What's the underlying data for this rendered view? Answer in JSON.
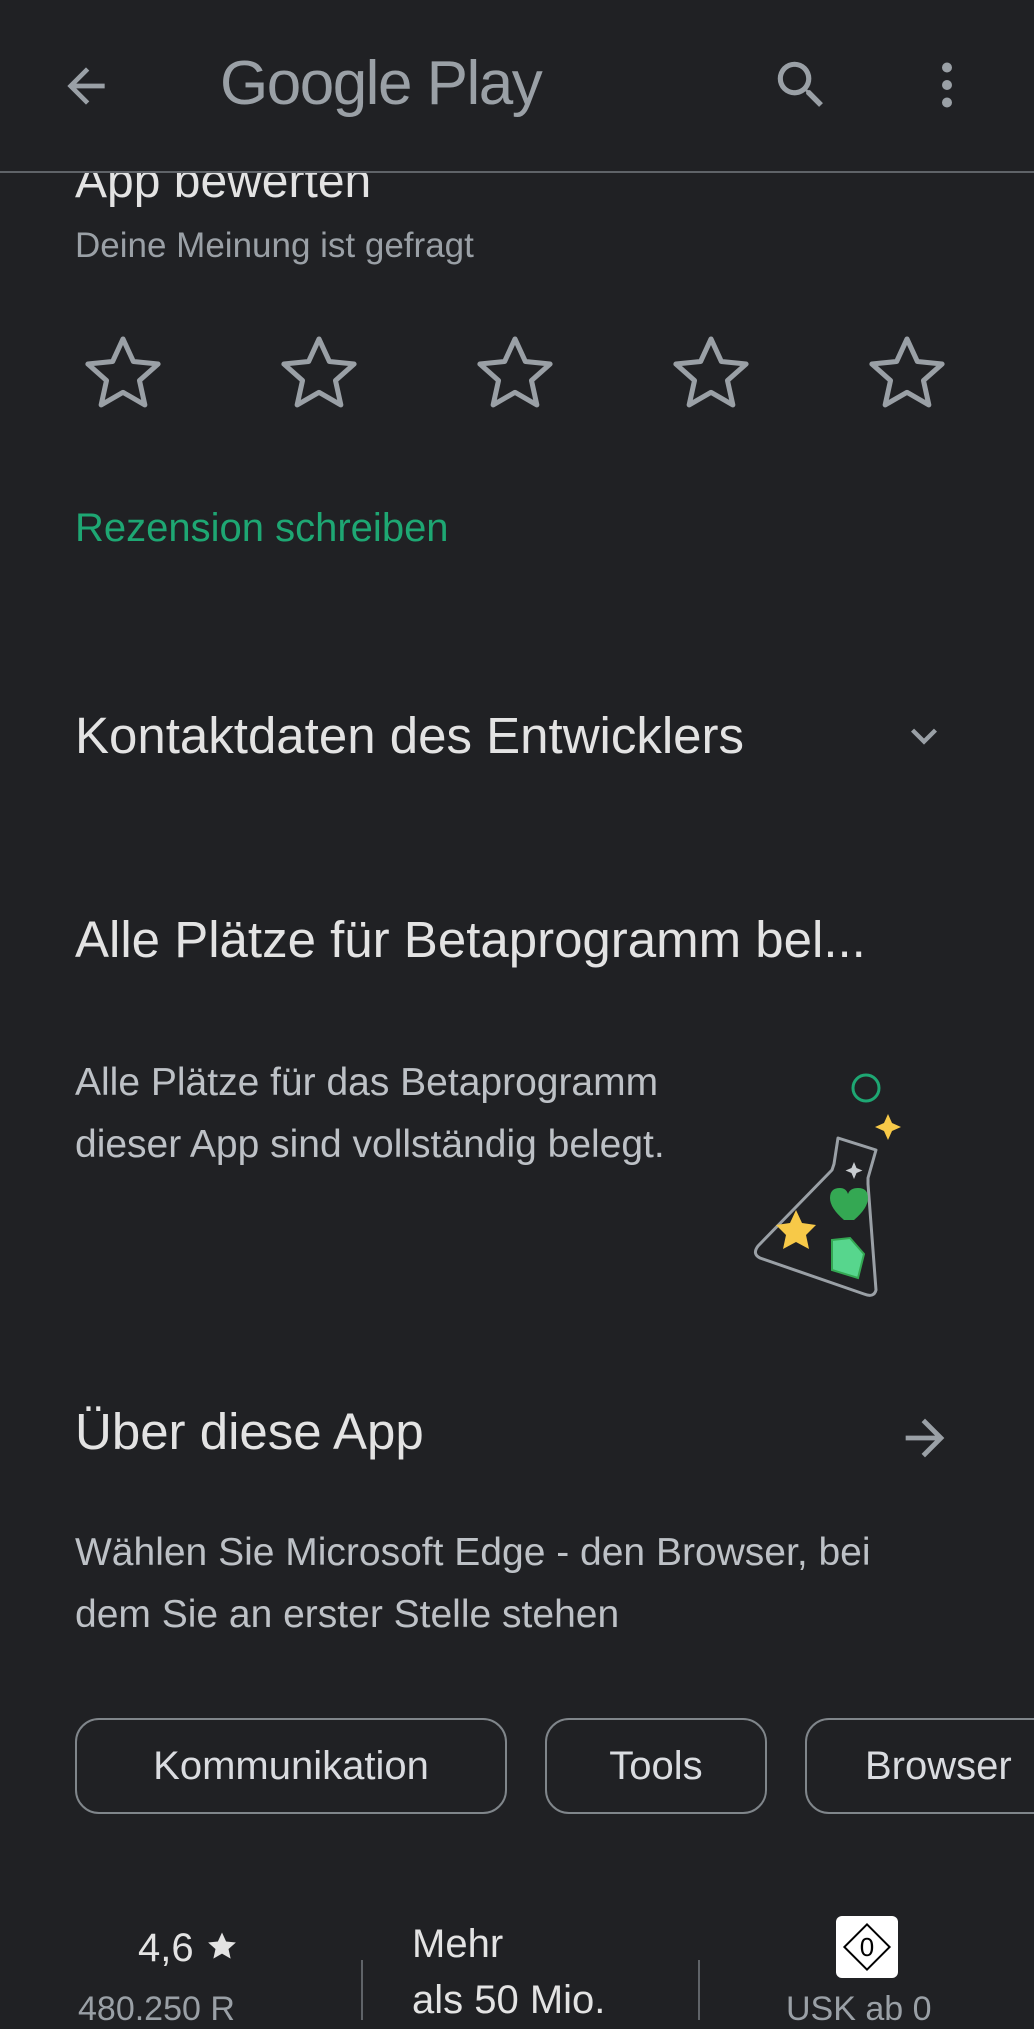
{
  "header": {
    "brand": "Google Play",
    "back_icon": "arrow-left-icon",
    "search_icon": "search-icon",
    "menu_icon": "more-vert-icon"
  },
  "rate": {
    "title": "App bewerten",
    "subtitle": "Deine Meinung ist gefragt",
    "stars": [
      {
        "icon": "star-outline-icon"
      },
      {
        "icon": "star-outline-icon"
      },
      {
        "icon": "star-outline-icon"
      },
      {
        "icon": "star-outline-icon"
      },
      {
        "icon": "star-outline-icon"
      }
    ],
    "write_review": "Rezension schreiben"
  },
  "developer_contact": {
    "title": "Kontaktdaten des Entwicklers",
    "icon": "chevron-down-icon"
  },
  "beta": {
    "title": "Alle Plätze für Betaprogramm bel...",
    "description": "Alle Plätze für das Betaprogramm dieser App sind vollständig belegt.",
    "illustration": "beta-flask-icon"
  },
  "about": {
    "title": "Über diese App",
    "icon": "arrow-right-icon",
    "description": "Wählen Sie Microsoft Edge - den Browser, bei dem Sie an erster Stelle stehen"
  },
  "tags": [
    "Kommunikation",
    "Tools",
    "Browser"
  ],
  "stats": {
    "rating": "4,6",
    "rating_icon": "star-filled-icon",
    "rating_sub": "480.250 R",
    "downloads_line1": "Mehr",
    "downloads_line2": "als 50 Mio.",
    "usk_value": "0",
    "usk_sub": "USK ab 0"
  },
  "colors": {
    "background": "#202124",
    "accent_green": "#1ea773",
    "text_primary": "#e3e3e3",
    "text_secondary": "#9aa0a6"
  }
}
